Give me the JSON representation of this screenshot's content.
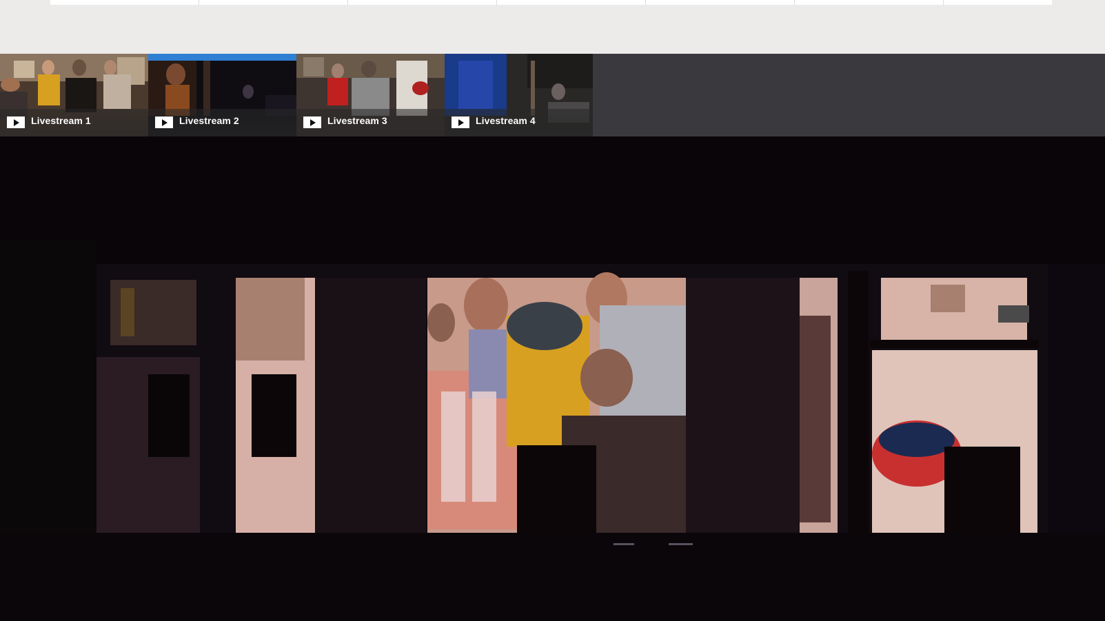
{
  "top_nav": {
    "tab_count": 7
  },
  "streams": [
    {
      "label": "Livestream 1",
      "icon": "play-icon",
      "active": false
    },
    {
      "label": "Livestream 2",
      "icon": "play-icon",
      "active": true
    },
    {
      "label": "Livestream 3",
      "icon": "play-icon",
      "active": false
    },
    {
      "label": "Livestream 4",
      "icon": "play-icon",
      "active": false
    }
  ],
  "colors": {
    "active_indicator": "#2f7fd3",
    "stream_bar_bg": "#3a393e",
    "page_bg": "#ecebea"
  }
}
